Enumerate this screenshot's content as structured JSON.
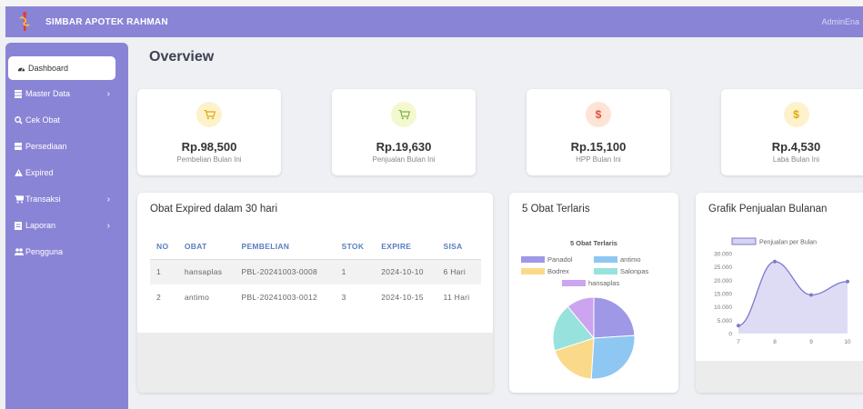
{
  "app": {
    "title": "SIMBAR APOTEK RAHMAN",
    "user": "AdminEna"
  },
  "sidebar": {
    "items": [
      {
        "label": "Dashboard",
        "icon": "dashboard-icon",
        "has_submenu": false
      },
      {
        "label": "Master Data",
        "icon": "database-icon",
        "has_submenu": true
      },
      {
        "label": "Cek Obat",
        "icon": "search-icon",
        "has_submenu": false
      },
      {
        "label": "Persediaan",
        "icon": "inventory-icon",
        "has_submenu": false
      },
      {
        "label": "Expired",
        "icon": "warning-icon",
        "has_submenu": false
      },
      {
        "label": "Transaksi",
        "icon": "cart-icon",
        "has_submenu": true
      },
      {
        "label": "Laporan",
        "icon": "report-icon",
        "has_submenu": true
      },
      {
        "label": "Pengguna",
        "icon": "users-icon",
        "has_submenu": false
      }
    ]
  },
  "overview": {
    "title": "Overview",
    "cards": [
      {
        "value": "Rp.98,500",
        "label": "Pembelian Bulan Ini",
        "icon": "cart-icon",
        "color": "#f2b705"
      },
      {
        "value": "Rp.19,630",
        "label": "Penjualan Bulan Ini",
        "icon": "cart-icon",
        "color": "#4caf50"
      },
      {
        "value": "Rp.15,100",
        "label": "HPP Bulan Ini",
        "icon": "dollar-icon",
        "color": "#e74c3c"
      },
      {
        "value": "Rp.4,530",
        "label": "Laba Bulan Ini",
        "icon": "dollar-icon",
        "color": "#f2b705"
      }
    ]
  },
  "expired": {
    "title": "Obat Expired dalam 30 hari",
    "headers": [
      "NO",
      "OBAT",
      "PEMBELIAN",
      "STOK",
      "EXPIRE",
      "SISA"
    ],
    "rows": [
      [
        "1",
        "hansaplas",
        "PBL-20241003-0008",
        "1",
        "2024-10-10",
        "6 Hari"
      ],
      [
        "2",
        "antimo",
        "PBL-20241003-0012",
        "3",
        "2024-10-15",
        "11 Hari"
      ]
    ]
  },
  "top_sellers": {
    "title": "5 Obat Terlaris"
  },
  "monthly_sales": {
    "title": "Grafik Penjualan Bulanan"
  },
  "chart_data": [
    {
      "type": "pie",
      "title": "5 Obat Terlaris",
      "categories": [
        "Panadol",
        "antimo",
        "Bodrex",
        "Salonpas",
        "hansaplas"
      ],
      "values": [
        24,
        27,
        19,
        19,
        11
      ],
      "colors": [
        "#9f98e6",
        "#8ec7f2",
        "#fbd98a",
        "#97e2dd",
        "#cda4ef"
      ],
      "legend": "top"
    },
    {
      "type": "area",
      "x": [
        "7",
        "8",
        "9",
        "10"
      ],
      "series": [
        {
          "name": "Penjualan per Bulan",
          "values": [
            3000,
            27000,
            14500,
            19500
          ]
        }
      ],
      "ylim": [
        0,
        30000
      ],
      "yticks": [
        "0",
        "5.000",
        "10.000",
        "15.000",
        "20.000",
        "25.000",
        "30.000"
      ],
      "color": "#7f79c9",
      "fill": "#d6d3f3",
      "legend": "top",
      "grid": false
    }
  ]
}
